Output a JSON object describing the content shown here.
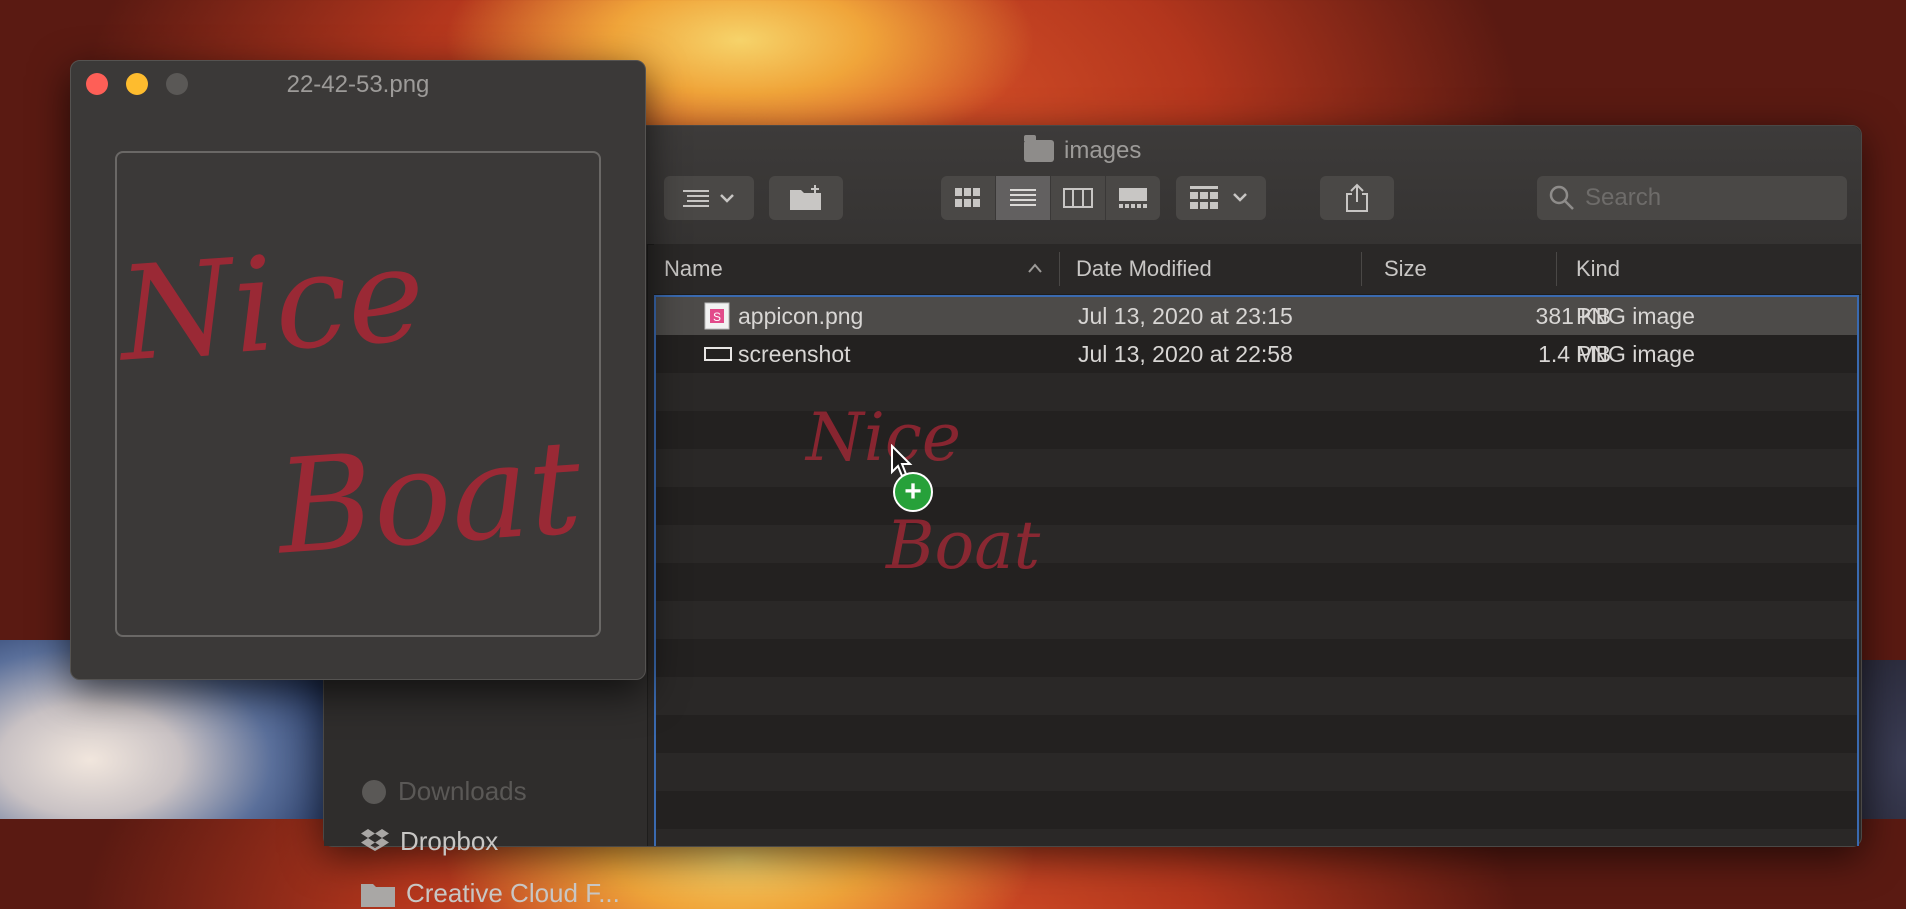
{
  "colors": {
    "close": "#fe5f57",
    "minimize": "#febc2e",
    "zoom": "#5a5856",
    "selection_border": "#3a6ab0",
    "drag_badge": "#27a13a",
    "ink": "#c0283a"
  },
  "preview_window": {
    "title": "22-42-53.png",
    "image_text": [
      "Nice",
      "Boat"
    ]
  },
  "finder_window": {
    "title": "images",
    "toolbar": {
      "items": [
        "list-options-icon",
        "new-folder-icon",
        "icon-view-icon",
        "list-view-icon",
        "column-view-icon",
        "gallery-view-icon",
        "group-by-icon",
        "share-icon"
      ],
      "active_view": "list"
    },
    "search": {
      "placeholder": "Search",
      "value": ""
    },
    "columns": [
      "Name",
      "Date Modified",
      "Size",
      "Kind"
    ],
    "sort_column": "Name",
    "files": [
      {
        "name": "appicon.png",
        "date": "Jul 13, 2020 at 23:15",
        "size": "381 KB",
        "kind": "PNG image",
        "selected": true
      },
      {
        "name": "screenshot",
        "date": "Jul 13, 2020 at 22:58",
        "size": "1.4 MB",
        "kind": "PNG image",
        "selected": false
      }
    ]
  },
  "sidebar": {
    "items": [
      {
        "label": "Downloads",
        "icon": "downloads-icon"
      },
      {
        "label": "Dropbox",
        "icon": "dropbox-icon"
      },
      {
        "label": "Creative Cloud F...",
        "icon": "folder-icon"
      }
    ]
  },
  "drag": {
    "ghost_text": [
      "Nice",
      "Boat"
    ],
    "badge": "+"
  }
}
